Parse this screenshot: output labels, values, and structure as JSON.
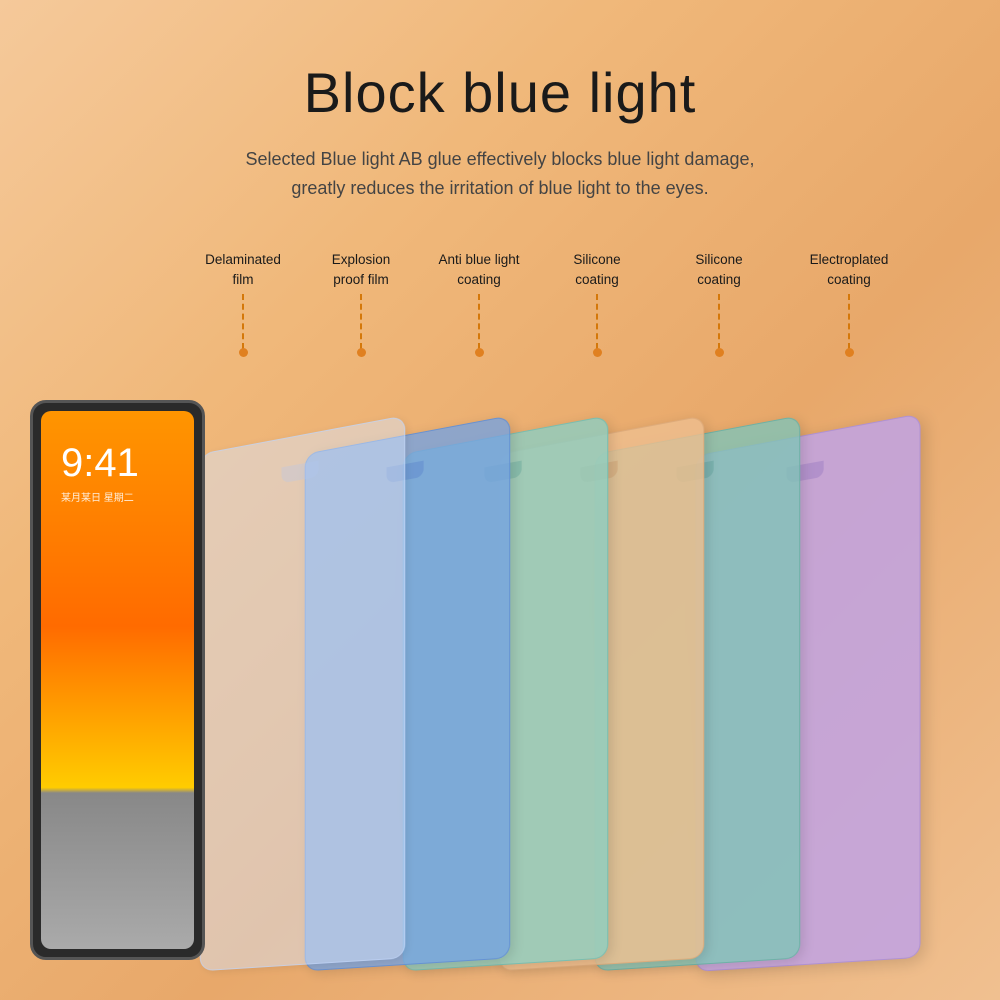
{
  "header": {
    "title": "Block blue light",
    "subtitle_line1": "Selected Blue light AB glue effectively blocks blue light damage,",
    "subtitle_line2": "greatly reduces the irritation of blue light to the eyes."
  },
  "layers": [
    {
      "id": "layer-1",
      "label_line1": "Delaminated",
      "label_line2": "film",
      "color_rgba": "rgba(215,230,255,0.55)",
      "border_rgba": "rgba(180,200,240,0.7)"
    },
    {
      "id": "layer-2",
      "label_line1": "Explosion",
      "label_line2": "proof film",
      "color_rgba": "rgba(120,165,225,0.78)",
      "border_rgba": "rgba(100,140,210,0.8)"
    },
    {
      "id": "layer-3",
      "label_line1": "Anti blue light",
      "label_line2": "coating",
      "color_rgba": "rgba(145,205,195,0.78)",
      "border_rgba": "rgba(120,190,180,0.8)"
    },
    {
      "id": "layer-4",
      "label_line1": "Silicone",
      "label_line2": "coating",
      "color_rgba": "rgba(238,190,145,0.78)",
      "border_rgba": "rgba(220,170,125,0.8)"
    },
    {
      "id": "layer-5",
      "label_line1": "Silicone",
      "label_line2": "coating",
      "color_rgba": "rgba(135,198,185,0.78)",
      "border_rgba": "rgba(110,178,168,0.8)"
    },
    {
      "id": "layer-6",
      "label_line1": "Electroplated",
      "label_line2": "coating",
      "color_rgba": "rgba(195,165,228,0.83)",
      "border_rgba": "rgba(175,145,210,0.8)"
    }
  ],
  "ipad": {
    "time": "9:41",
    "date_text": "某月某日 星期二"
  },
  "connector": {
    "dot_color": "#e08020",
    "line_color": "#d4780a"
  }
}
